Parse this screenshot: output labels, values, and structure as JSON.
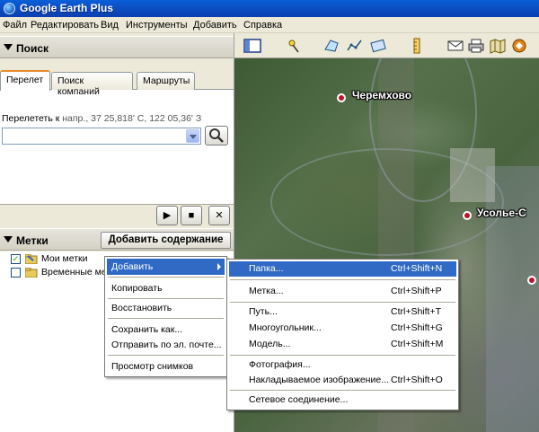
{
  "window": {
    "title": "Google Earth Plus"
  },
  "menubar": [
    "Файл",
    "Редактировать",
    "Вид",
    "Инструменты",
    "Добавить",
    "Справка"
  ],
  "search_panel": {
    "header": "Поиск",
    "tabs": [
      "Перелет",
      "Поиск компаний",
      "Маршруты"
    ],
    "fly_label": "Перелететь к",
    "fly_hint": "напр., 37 25,818' С, 122 05,36' З",
    "fly_value": ""
  },
  "playback": {
    "play": "▶",
    "stop": "■",
    "close": "✕"
  },
  "places_panel": {
    "header": "Метки",
    "add_content": "Добавить содержание",
    "items": [
      {
        "label": "Мои метки",
        "checked": true,
        "check_mark": "✓"
      },
      {
        "label": "Временные метки",
        "checked": false,
        "check_mark": ""
      }
    ]
  },
  "map": {
    "places": [
      {
        "name": "Черемхово"
      },
      {
        "name": "Усолье-С"
      }
    ]
  },
  "context_menu": {
    "items": [
      "Добавить",
      "Копировать",
      "Восстановить",
      "Сохранить как...",
      "Отправить по эл. почте...",
      "Просмотр снимков"
    ]
  },
  "submenu": {
    "items": [
      {
        "label": "Папка...",
        "shortcut": "Ctrl+Shift+N"
      },
      {
        "label": "Метка...",
        "shortcut": "Ctrl+Shift+P"
      },
      {
        "label": "Путь...",
        "shortcut": "Ctrl+Shift+T"
      },
      {
        "label": "Многоугольник...",
        "shortcut": "Ctrl+Shift+G"
      },
      {
        "label": "Модель...",
        "shortcut": "Ctrl+Shift+M"
      },
      {
        "label": "Фотография...",
        "shortcut": ""
      },
      {
        "label": "Накладываемое изображение...",
        "shortcut": "Ctrl+Shift+O"
      },
      {
        "label": "Сетевое соединение...",
        "shortcut": ""
      }
    ]
  },
  "colors": {
    "highlight": "#316ac5",
    "titlebar": "#0a5fd8",
    "place_dot": "#c0102a"
  },
  "icons": [
    "app-globe-icon",
    "sidebar-toggle-icon",
    "placemark-pin-icon",
    "polygon-icon",
    "path-icon",
    "image-overlay-icon",
    "ruler-icon",
    "email-icon",
    "print-icon",
    "map-icon",
    "google-maps-icon",
    "search-magnifier-icon"
  ]
}
